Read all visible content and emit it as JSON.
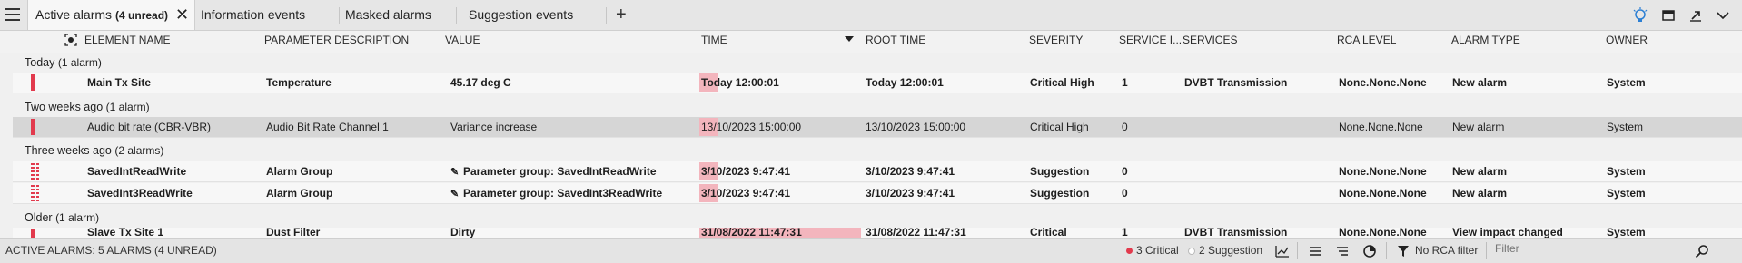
{
  "tabs": [
    {
      "label": "Active alarms",
      "sub": "(4 unread)",
      "active": true
    },
    {
      "label": "Information events"
    },
    {
      "label": "Masked alarms"
    },
    {
      "label": "Suggestion events"
    }
  ],
  "columns": {
    "element": "ELEMENT NAME",
    "param": "PARAMETER DESCRIPTION",
    "value": "VALUE",
    "time": "TIME",
    "root": "ROOT TIME",
    "severity": "SEVERITY",
    "servicei": "SERVICE I...",
    "services": "SERVICES",
    "rca": "RCA LEVEL",
    "type": "ALARM TYPE",
    "owner": "OWNER"
  },
  "groups": {
    "today": {
      "label": "Today",
      "count": "(1 alarm)"
    },
    "twoweeks": {
      "label": "Two weeks ago",
      "count": "(1 alarm)"
    },
    "threeweeks": {
      "label": "Three weeks ago",
      "count": "(2 alarms)"
    },
    "older": {
      "label": "Older",
      "count": "(1 alarm)"
    }
  },
  "rows": [
    {
      "element": "Main Tx Site",
      "param": "Temperature",
      "value": "45.17 deg C",
      "time": "Today 12:00:01",
      "root": "Today 12:00:01",
      "severity": "Critical High",
      "servicei": "1",
      "services": "DVBT Transmission",
      "rca": "None.None.None",
      "type": "New alarm",
      "owner": "System"
    },
    {
      "element": "Audio bit rate (CBR-VBR)",
      "param": "Audio Bit Rate Channel 1",
      "value": "Variance increase",
      "time": "13/10/2023 15:00:00",
      "root": "13/10/2023 15:00:00",
      "severity": "Critical High",
      "servicei": "0",
      "services": "",
      "rca": "None.None.None",
      "type": "New alarm",
      "owner": "System"
    },
    {
      "element": "SavedIntReadWrite",
      "param": "Alarm Group",
      "value": "Parameter group: SavedIntReadWrite",
      "time": "3/10/2023 9:47:41",
      "root": "3/10/2023 9:47:41",
      "severity": "Suggestion",
      "servicei": "0",
      "services": "",
      "rca": "None.None.None",
      "type": "New alarm",
      "owner": "System"
    },
    {
      "element": "SavedInt3ReadWrite",
      "param": "Alarm Group",
      "value": "Parameter group: SavedInt3ReadWrite",
      "time": "3/10/2023 9:47:41",
      "root": "3/10/2023 9:47:41",
      "severity": "Suggestion",
      "servicei": "0",
      "services": "",
      "rca": "None.None.None",
      "type": "New alarm",
      "owner": "System"
    },
    {
      "element": "Slave Tx Site 1",
      "param": "Dust Filter",
      "value": "Dirty",
      "time": "31/08/2022 11:47:31",
      "root": "31/08/2022 11:47:31",
      "severity": "Critical",
      "servicei": "1",
      "services": "DVBT Transmission",
      "rca": "None.None.None",
      "type": "View impact changed",
      "owner": "System"
    }
  ],
  "status": {
    "summary": "ACTIVE ALARMS: 5 ALARMS (4 UNREAD)",
    "critical": "3 Critical",
    "suggestion": "2 Suggestion",
    "rca_filter": "No RCA filter",
    "filter_placeholder": "Filter"
  },
  "colors": {
    "critical": "#e23a4d",
    "time_highlight": "#f3b5bd"
  }
}
